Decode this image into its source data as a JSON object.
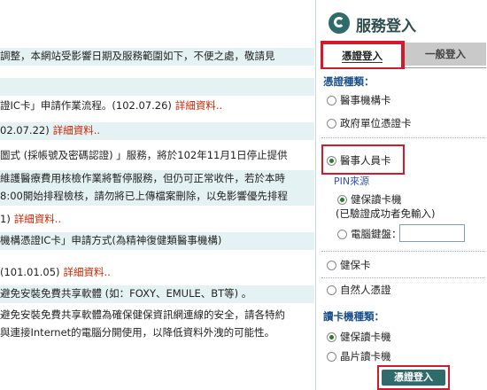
{
  "news": [
    {
      "text": "調整，本網站受影響日期及服務範圍如下，不便之處，敬請見",
      "link": "",
      "shade": true
    },
    {
      "text": "",
      "link": "",
      "shade": true
    },
    {
      "text": "證IC卡」申請作業流程。(102.07.26)",
      "link": "詳細資料..",
      "shade": false
    },
    {
      "text": "02.07.22)",
      "link": "詳細資料..",
      "shade": true
    },
    {
      "text": "圖式 (採帳號及密碼認證) 」服務，將於102年11月1日停止提供",
      "link": "",
      "shade": false
    },
    {
      "text": "維護醫療費用核檢作業將暫停服務，但仍可正常收件，若於本時",
      "link": "",
      "shade": true
    },
    {
      "text": "8:00開始排程檢核，請勿將已上傳檔案刪除，以免影響優先排程",
      "link": "",
      "shade": true
    },
    {
      "text": "1)",
      "link": "詳細資料..",
      "shade": false
    },
    {
      "text": "機構憑證IC卡」申請方式(為精神復健類醫事機構)",
      "link": "",
      "shade": true
    },
    {
      "text": "(101.01.05)",
      "link": "詳細資料..",
      "shade": false
    },
    {
      "text": "避免安裝免費共享軟體 (如：FOXY、EMULE、BT等) 。",
      "link": "",
      "shade": true
    },
    {
      "text": "避免安裝免費共享軟體為確保健保資訊網連線的安全，請各特約",
      "link": "",
      "shade": false
    },
    {
      "text": "與連接Internet的電腦分開使用，以降低資料外洩的可能性。",
      "link": "",
      "shade": false
    }
  ],
  "login": {
    "title": "服務登入",
    "tab_active": "憑證登入",
    "tab_inactive": "一般登入",
    "cert_type_label": "憑證種類：",
    "cert_types": [
      "醫事機構卡",
      "政府單位憑證卡",
      "醫事人員卡"
    ],
    "pin_source_label": "PIN來源",
    "pin_options": [
      "健保讀卡機",
      "(已驗證成功者免輸入)",
      "電腦鍵盤："
    ],
    "card_types": [
      "健保卡",
      "自然人憑證"
    ],
    "reader_type_label": "讀卡機種類：",
    "reader_types": [
      "健保讀卡機",
      "晶片讀卡機"
    ],
    "submit": "憑證登入"
  }
}
